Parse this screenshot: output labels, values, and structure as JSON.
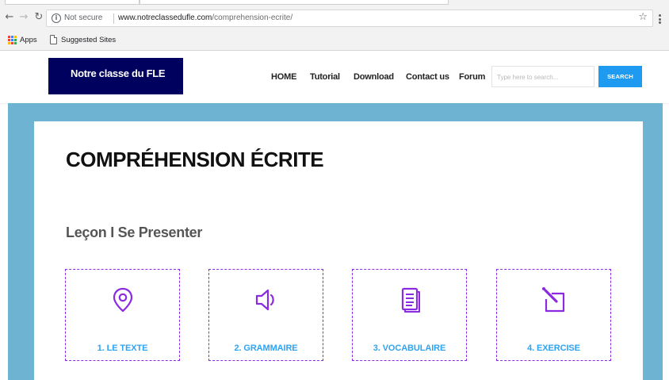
{
  "browser": {
    "security_label": "Not secure",
    "url_domain": "www.notreclassedufle.com",
    "url_path": "/comprehension-ecrite/",
    "bookmarks": {
      "apps_label": "Apps",
      "suggested_label": "Suggested Sites"
    }
  },
  "site": {
    "logo_text": "Notre classe du FLE",
    "nav": [
      "HOME",
      "Tutorial",
      "Download",
      "Contact us",
      "Forum"
    ],
    "search_placeholder": "Type here to search...",
    "search_button": "SEARCH"
  },
  "main": {
    "page_title": "COMPRÉHENSION ÉCRITE",
    "lesson_title": "Leçon I Se Presenter",
    "sections": [
      {
        "label": "1. LE TEXTE",
        "icon": "location-pin-icon"
      },
      {
        "label": "2. GRAMMAIRE",
        "icon": "speaker-icon"
      },
      {
        "label": "3. VOCABULAIRE",
        "icon": "document-icon"
      },
      {
        "label": "4. EXERCISE",
        "icon": "edit-pencil-icon"
      }
    ]
  },
  "colors": {
    "logo_bg": "#00005e",
    "accent_blue": "#1e9bf0",
    "label_blue": "#2ea3f2",
    "icon_purple": "#8a2be2",
    "page_bg": "#6fb3d2"
  }
}
